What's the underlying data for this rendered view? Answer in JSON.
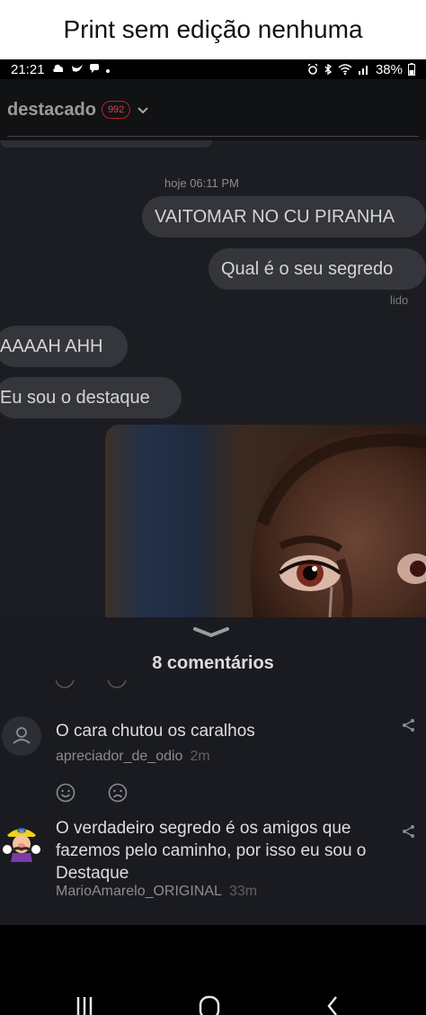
{
  "caption": "Print sem edição nenhuma",
  "status_bar": {
    "time": "21:21",
    "battery_percent": "38%"
  },
  "header": {
    "title": "destacado",
    "badge_count": "992"
  },
  "chat": {
    "timestamp": "hoje 06:11 PM",
    "messages": [
      {
        "from": "me",
        "text": "VAITOMAR NO CU PIRANHA"
      },
      {
        "from": "me",
        "text": "Qual é o seu segredo"
      },
      {
        "from": "them",
        "text": "AAAAH AHH"
      },
      {
        "from": "them",
        "text": "Eu sou o destaque"
      }
    ],
    "seen_label": "lido"
  },
  "comments": {
    "title": "8 comentários",
    "items": [
      {
        "text": "O cara chutou os caralhos",
        "author": "apreciador_de_odio",
        "time": "2m"
      },
      {
        "text": "O verdadeiro segredo é os amigos que fazemos pelo caminho, por isso eu sou o Destaque",
        "author": "MarioAmarelo_ORIGINAL",
        "time": "33m"
      }
    ]
  },
  "colors": {
    "badge": "#b3232a",
    "bubble": "#34363c",
    "background": "#1c1d22"
  },
  "icons": [
    "chevron-down-icon",
    "share-icon",
    "smile-icon",
    "frown-icon",
    "user-icon",
    "recents-icon",
    "home-icon",
    "back-icon"
  ]
}
